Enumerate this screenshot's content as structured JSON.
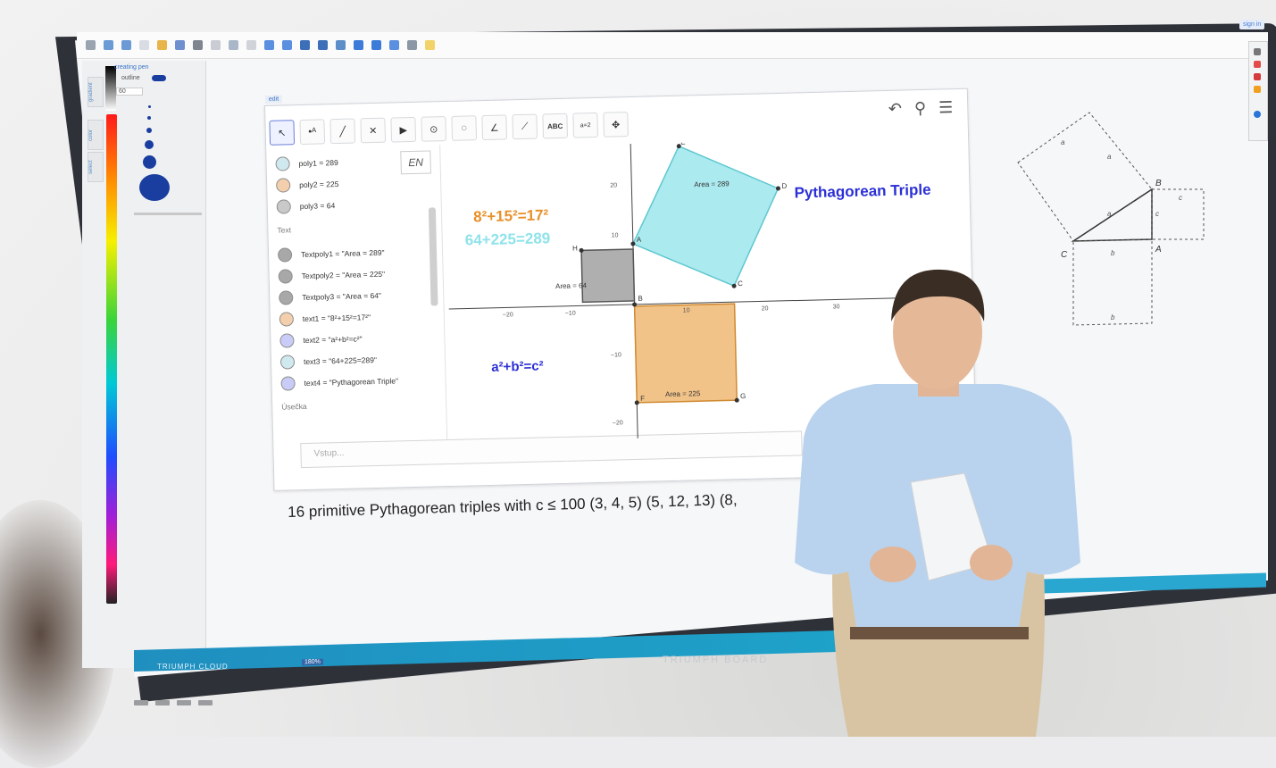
{
  "board": {
    "brand_label": "TRIUMPH BOARD",
    "cloud_label": "TRIUMPH CLOUD",
    "sign_in": "sign in",
    "zoom": "180%"
  },
  "pen_panel": {
    "title": "creating pen",
    "outline_label": "outline",
    "size_value": "60",
    "tabs": [
      "gradient",
      "color",
      "select"
    ]
  },
  "geogebra": {
    "edit_label": "edit",
    "text_tool": "ABC",
    "slider_tool": "a=2",
    "algebra": [
      {
        "label": "poly1 = 289",
        "color": "#cfe9ee"
      },
      {
        "label": "poly2 = 225",
        "color": "#f3cfad"
      },
      {
        "label": "poly3 = 64",
        "color": "#c9c9c9"
      },
      {
        "label": "Textpoly1 = \"Area = 289\"",
        "color": "#a8a8a8"
      },
      {
        "label": "Textpoly2 = \"Area = 225\"",
        "color": "#a8a8a8"
      },
      {
        "label": "Textpoly3 = \"Area = 64\"",
        "color": "#a8a8a8"
      },
      {
        "label": "text1 = \"8²+15²=17²\"",
        "color": "#f3cfad"
      },
      {
        "label": "text2 = \"a²+b²=c²\"",
        "color": "#c9ccf7"
      },
      {
        "label": "text3 = \"64+225=289\"",
        "color": "#cfe9ee"
      },
      {
        "label": "text4 = \"Pythagorean Triple\"",
        "color": "#c9ccf7"
      }
    ],
    "group_text": "Text",
    "group_segment": "Úsečka",
    "input_placeholder": "Vstup...",
    "equation_orange": "8²+15²=17²",
    "equation_cyan": "64+225=289",
    "equation_blue": "a²+b²=c²",
    "triple_label": "Pythagorean Triple",
    "area_289": "Area = 289",
    "area_225": "Area = 225",
    "area_64": "Area = 64",
    "points": [
      "A",
      "B",
      "C",
      "D",
      "E",
      "F",
      "G",
      "H"
    ],
    "y_ticks": [
      "20",
      "10",
      "−10",
      "−20"
    ],
    "x_ticks": [
      "−20",
      "−10",
      "10",
      "20",
      "30",
      "40",
      "50"
    ],
    "colors": {
      "cyan": "#8fe3ea",
      "orange": "#f0b874",
      "gray": "#9b9b9b",
      "blue": "#2b2fd6",
      "orange_text": "#e8902a"
    }
  },
  "caption": "16 primitive Pythagorean triples with c ≤ 100  (3, 4, 5) (5, 12, 13) (8,",
  "sketch_labels": {
    "B": "B",
    "C": "C",
    "A": "A",
    "a": "a",
    "b": "b",
    "c": "c"
  }
}
